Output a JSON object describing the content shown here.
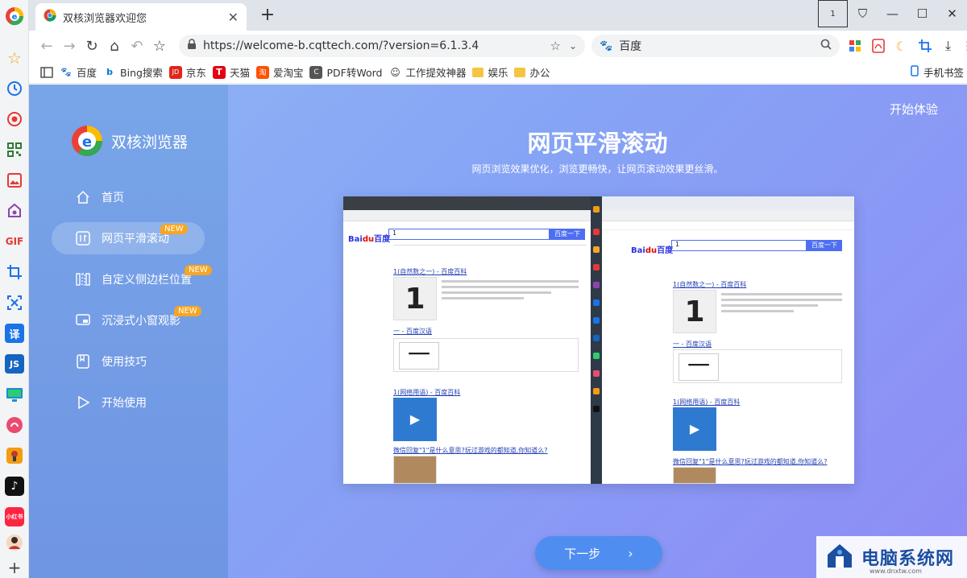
{
  "tab": {
    "title": "双核浏览器欢迎您",
    "close": "✕",
    "new_tab": "+"
  },
  "window_controls": [
    "1",
    "⛉",
    "—",
    "☐",
    "✕"
  ],
  "nav": {
    "back": "←",
    "forward": "→",
    "reload": "↻",
    "home": "⌂",
    "undo": "↶",
    "star": "☆"
  },
  "address": {
    "url": "https://welcome-b.cqttech.com/?version=6.1.3.4"
  },
  "search": {
    "engine": "百度",
    "placeholder": ""
  },
  "bookmarks": [
    {
      "label": "百度",
      "color": "#2932e1",
      "icon": "🐾"
    },
    {
      "label": "Bing搜索",
      "color": "#0078d7",
      "icon": "b"
    },
    {
      "label": "京东",
      "color": "#e1251b",
      "icon": "JD"
    },
    {
      "label": "天猫",
      "color": "#e50012",
      "icon": "T"
    },
    {
      "label": "爱淘宝",
      "color": "#ff5000",
      "icon": "淘"
    },
    {
      "label": "PDF转Word",
      "color": "#555555",
      "icon": "C"
    },
    {
      "label": "工作提效神器",
      "color": "#888888",
      "icon": "☺"
    },
    {
      "label": "娱乐",
      "color": "#f5c542",
      "icon": ""
    },
    {
      "label": "办公",
      "color": "#f5c542",
      "icon": ""
    }
  ],
  "bookmarks_right": "手机书签",
  "brand": {
    "name": "双核浏览器"
  },
  "menu": [
    {
      "label": "首页",
      "new": ""
    },
    {
      "label": "网页平滑滚动",
      "new": "NEW"
    },
    {
      "label": "自定义侧边栏位置",
      "new": "NEW"
    },
    {
      "label": "沉浸式小窗观影",
      "new": "NEW"
    },
    {
      "label": "使用技巧",
      "new": ""
    },
    {
      "label": "开始使用",
      "new": ""
    }
  ],
  "start_link": "开始体验",
  "heading": "网页平滑滚动",
  "subheading": "网页浏览效果优化，浏览更畅快，让网页滚动效果更丝滑。",
  "preview": {
    "left": {
      "search_value": "1",
      "button": "百度一下",
      "result1_title": "1(自然数之一) - 百度百科",
      "result2_title": "一 - 百度汉语",
      "result3_title": "1(网络用语) - 百度百科",
      "result4_title": "微信回复\"1\"是什么意思?玩过游戏的都知道,你知道么?"
    },
    "right": {
      "search_value": "1",
      "button": "百度一下",
      "result1_title": "1(自然数之一) - 百度百科",
      "result2_title": "一 - 百度汉语",
      "result3_title": "1(网络用语) - 百度百科",
      "result4_title": "微信回复\"1\"是什么意思?玩过游戏的都知道,你知道么?"
    }
  },
  "next_button": "下一步",
  "watermark": {
    "name": "电脑系统网",
    "url": "www.dnxtw.com"
  }
}
